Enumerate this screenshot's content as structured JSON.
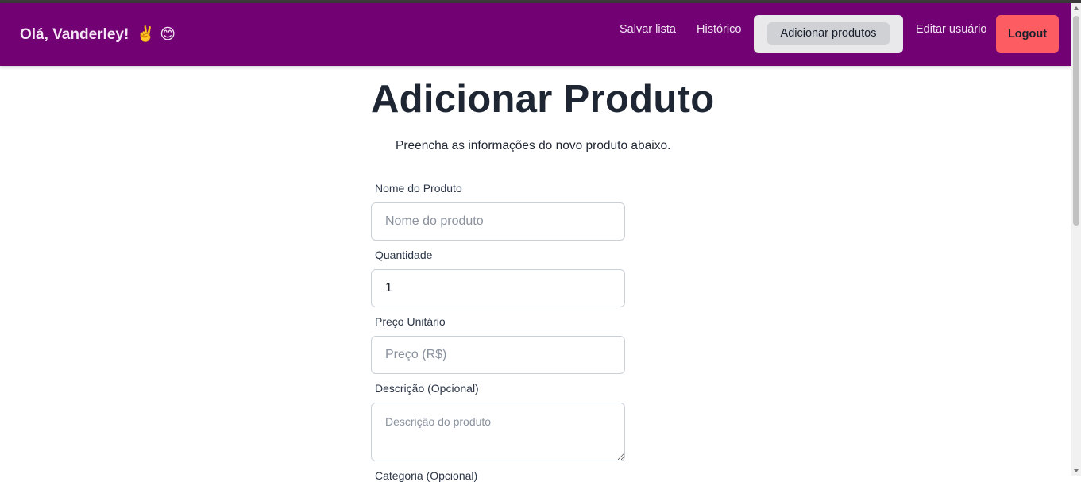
{
  "header": {
    "greeting": "Olá, Vanderley!",
    "greeting_emoji": "✌️ 😊",
    "nav": {
      "save_list": "Salvar lista",
      "history": "Histórico",
      "add_products": "Adicionar produtos",
      "edit_user": "Editar usuário",
      "logout": "Logout"
    },
    "brand_color": "#720174",
    "logout_color": "#fc5c62"
  },
  "main": {
    "title": "Adicionar Produto",
    "subtitle": "Preencha as informações do novo produto abaixo.",
    "form": {
      "name": {
        "label": "Nome do Produto",
        "placeholder": "Nome do produto",
        "value": ""
      },
      "quantity": {
        "label": "Quantidade",
        "placeholder": "",
        "value": "1"
      },
      "price": {
        "label": "Preço Unitário",
        "placeholder": "Preço (R$)",
        "value": ""
      },
      "description": {
        "label": "Descrição (Opcional)",
        "placeholder": "Descrição do produto",
        "value": ""
      },
      "category": {
        "label": "Categoria (Opcional)"
      }
    }
  }
}
